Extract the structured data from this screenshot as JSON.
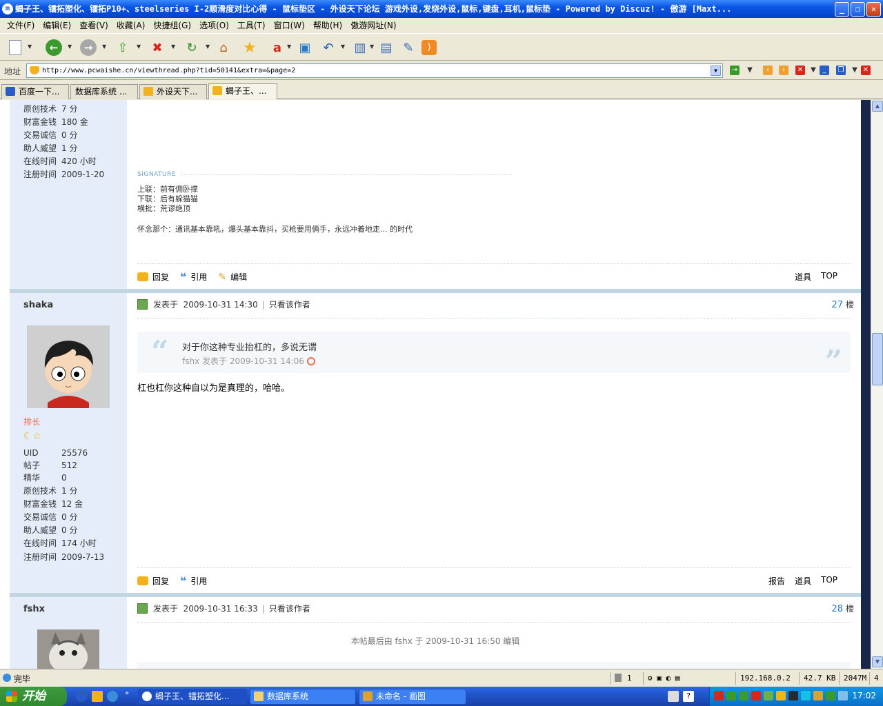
{
  "window": {
    "title": "蝎子王、镭拓塑化、镭拓P10+、steelseries I-2顺滑度对比心得 - 鼠标垫区 - 外设天下论坛 游戏外设,发烧外设,鼠标,键盘,耳机,鼠标垫 - Powered by Discuz! - 傲游 [Maxt..."
  },
  "menu": [
    "文件(F)",
    "编辑(E)",
    "查看(V)",
    "收藏(A)",
    "快捷组(G)",
    "选项(O)",
    "工具(T)",
    "窗口(W)",
    "帮助(H)",
    "傲游网址(N)"
  ],
  "address": {
    "label": "地址",
    "url": "http://www.pcwaishe.cn/viewthread.php?tid=50141&extra=&page=2"
  },
  "tabs": [
    {
      "label": "百度一下..."
    },
    {
      "label": "数据库系统 ..."
    },
    {
      "label": "外设天下..."
    },
    {
      "label": "蝎子王、..."
    }
  ],
  "post1": {
    "stats": [
      {
        "k": "原创技术",
        "v": "7 分"
      },
      {
        "k": "财富金钱",
        "v": "180 金"
      },
      {
        "k": "交易诚信",
        "v": "0 分"
      },
      {
        "k": "助人威望",
        "v": "1 分"
      },
      {
        "k": "在线时间",
        "v": "420 小时"
      },
      {
        "k": "注册时间",
        "v": "2009-1-20"
      }
    ],
    "signature_title": "SIGNATURE",
    "signature_lines": [
      "上联：前有佣卧撑",
      "下联：后有躲猫猫",
      "横批：荒谬绝顶"
    ],
    "signature_extra": "怀念那个：通讯基本靠吼，爆头基本靠抖，买枪要用俩手，永远冲着地走...  的时代",
    "actions": [
      "回复",
      "引用",
      "编辑"
    ],
    "right_links": [
      "道具",
      "TOP"
    ]
  },
  "post2": {
    "username": "shaka",
    "meta_prefix": "发表于",
    "date": "2009-10-31 14:30",
    "only_author": "只看该作者",
    "floor_num": "27",
    "floor_unit": "楼",
    "quote_text": "对于你这种专业抬杠的，多说无谓",
    "quote_meta": "fshx 发表于  2009-10-31 14:06",
    "body": "杠也杠你这种自以为是真理的，哈哈。",
    "rank": "排长",
    "stars": "☾☆",
    "stats": [
      {
        "k": "UID",
        "v": "25576"
      },
      {
        "k": "帖子",
        "v": "512"
      },
      {
        "k": "精华",
        "v": "0"
      },
      {
        "k": "原创技术",
        "v": "1 分"
      },
      {
        "k": "财富金钱",
        "v": "12 金"
      },
      {
        "k": "交易诚信",
        "v": "0 分"
      },
      {
        "k": "助人威望",
        "v": "0 分"
      },
      {
        "k": "在线时间",
        "v": "174 小时"
      },
      {
        "k": "注册时间",
        "v": "2009-7-13"
      }
    ],
    "actions": [
      "回复",
      "引用"
    ],
    "right_links": [
      "报告",
      "道具",
      "TOP"
    ]
  },
  "post3": {
    "username": "fshx",
    "meta_prefix": "发表于",
    "date": "2009-10-31 16:33",
    "only_author": "只看该作者",
    "floor_num": "28",
    "floor_unit": "楼",
    "edit_note": "本帖最后由 fshx 于 2009-10-31 16:50 编辑"
  },
  "status": {
    "text": "完毕",
    "count": "1",
    "ip": "192.168.0.2",
    "size": "42.7 KB",
    "mem": "2047M",
    "extra": "4"
  },
  "taskbar": {
    "start": "开始",
    "tasks": [
      {
        "label": "蝎子王、镭拓塑化..."
      },
      {
        "label": "数据库系统"
      },
      {
        "label": "未命名 - 画图"
      }
    ],
    "clock": "17:02"
  },
  "colors": {
    "accent_blue": "#2b7acd",
    "side_bg": "#e4edf9",
    "separator": "#c2d5e3",
    "rank": "#f26c4f"
  }
}
